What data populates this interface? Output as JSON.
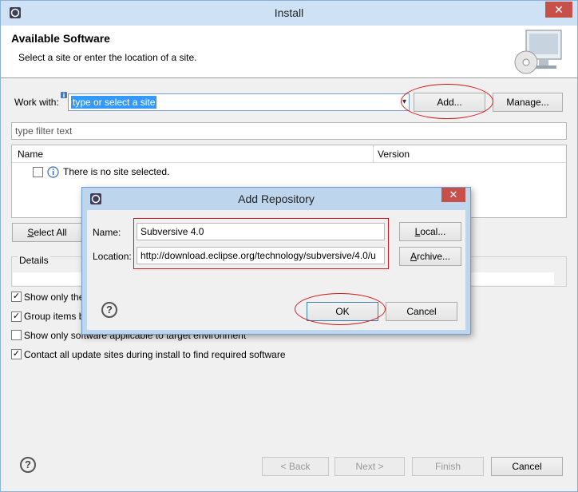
{
  "window": {
    "title": "Install",
    "close_glyph": "✕"
  },
  "header": {
    "heading": "Available Software",
    "subtitle": "Select a site or enter the location of a site."
  },
  "work_with": {
    "label": "Work with:",
    "value": "type or select a site",
    "add_label": "Add...",
    "manage_label": "Manage..."
  },
  "filter": {
    "placeholder": "type filter text"
  },
  "table": {
    "columns": [
      "Name",
      "Version"
    ],
    "rows": [
      {
        "text": "There is no site selected."
      }
    ]
  },
  "side_buttons": {
    "select_all": "Select All"
  },
  "details": {
    "label": "Details"
  },
  "options": [
    {
      "label": "Show only the",
      "checked": true
    },
    {
      "label": "Group items b",
      "checked": true
    },
    {
      "label": "Show only software applicable to target environment",
      "checked": false
    },
    {
      "label": "Contact all update sites during install to find required software",
      "checked": true
    }
  ],
  "footer": {
    "back": "< Back",
    "next": "Next >",
    "finish": "Finish",
    "cancel": "Cancel"
  },
  "dialog": {
    "title": "Add Repository",
    "close_glyph": "✕",
    "name_label": "Name:",
    "name_value": "Subversive 4.0",
    "local_label": "Local...",
    "location_label": "Location:",
    "location_value": "http://download.eclipse.org/technology/subversive/4.0/u",
    "archive_label": "Archive...",
    "ok_label": "OK",
    "cancel_label": "Cancel"
  },
  "colors": {
    "annotation": "#d61818",
    "selection": "#3399ff",
    "titlebar": "#cfe2f5"
  }
}
